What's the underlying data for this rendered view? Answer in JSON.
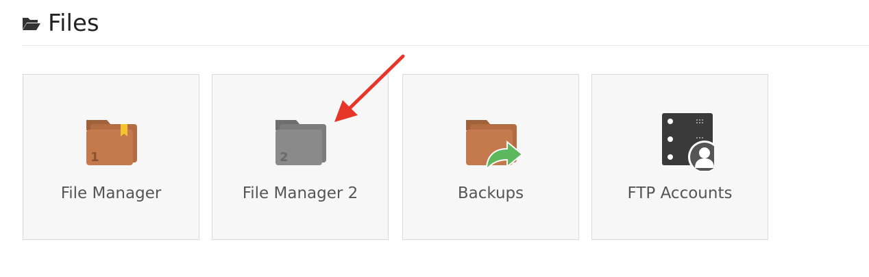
{
  "section": {
    "title": "Files",
    "icon": "folder-open-icon"
  },
  "tiles": [
    {
      "label": "File Manager",
      "icon": "file-manager-folder-icon",
      "badge": "1",
      "color": "#c47a4c"
    },
    {
      "label": "File Manager 2",
      "icon": "file-manager-2-folder-icon",
      "badge": "2",
      "color": "#8a8a8a"
    },
    {
      "label": "Backups",
      "icon": "backups-folder-arrow-icon",
      "color": "#c47a4c",
      "accent": "#5cb85c"
    },
    {
      "label": "FTP Accounts",
      "icon": "ftp-accounts-server-user-icon",
      "color": "#3a3a3a"
    }
  ],
  "annotation": {
    "color": "#e8352a"
  }
}
